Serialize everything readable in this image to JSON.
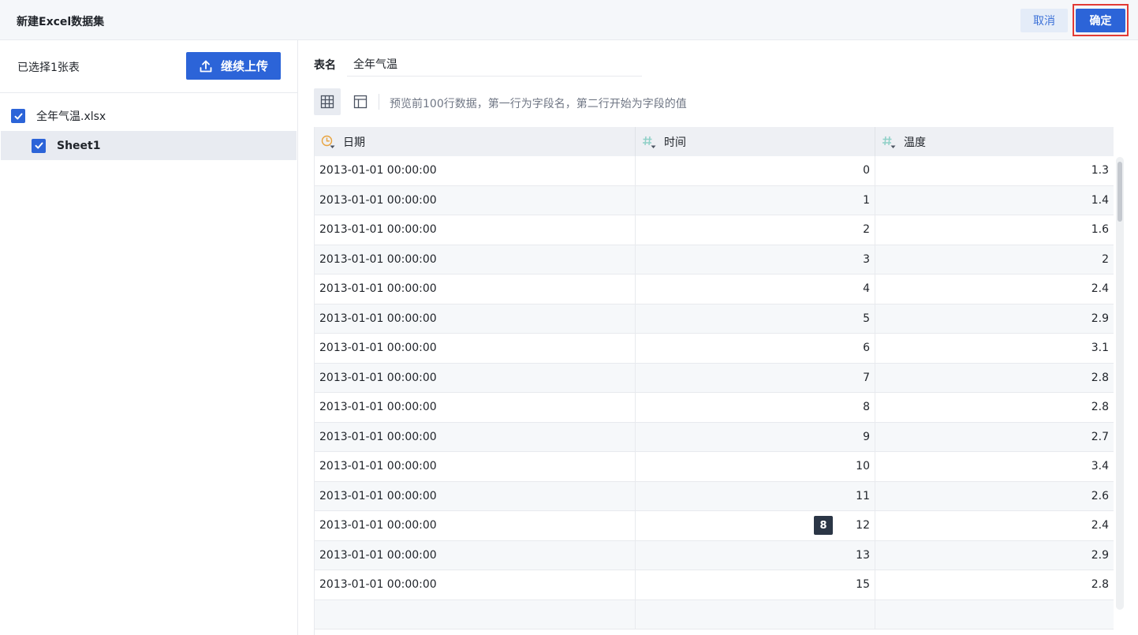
{
  "header": {
    "title": "新建Excel数据集",
    "cancel_label": "取消",
    "confirm_label": "确定"
  },
  "left_panel": {
    "selected_count": "已选择1张表",
    "upload_label": "继续上传",
    "file": {
      "name": "全年气温.xlsx",
      "checked": true
    },
    "sheet": {
      "name": "Sheet1",
      "checked": true
    }
  },
  "main": {
    "table_name_label": "表名",
    "table_name_value": "全年气温",
    "hint": "预览前100行数据，第一行为字段名，第二行开始为字段的值",
    "badge": "8",
    "columns": [
      {
        "name": "日期",
        "type_icon": "clock-icon",
        "type_color": "#e8a33d"
      },
      {
        "name": "时间",
        "type_icon": "hash-icon",
        "type_color": "#8fd0c7"
      },
      {
        "name": "温度",
        "type_icon": "hash-icon",
        "type_color": "#8fd0c7"
      }
    ],
    "rows": [
      [
        "2013-01-01 00:00:00",
        "0",
        "1.3"
      ],
      [
        "2013-01-01 00:00:00",
        "1",
        "1.4"
      ],
      [
        "2013-01-01 00:00:00",
        "2",
        "1.6"
      ],
      [
        "2013-01-01 00:00:00",
        "3",
        "2"
      ],
      [
        "2013-01-01 00:00:00",
        "4",
        "2.4"
      ],
      [
        "2013-01-01 00:00:00",
        "5",
        "2.9"
      ],
      [
        "2013-01-01 00:00:00",
        "6",
        "3.1"
      ],
      [
        "2013-01-01 00:00:00",
        "7",
        "2.8"
      ],
      [
        "2013-01-01 00:00:00",
        "8",
        "2.8"
      ],
      [
        "2013-01-01 00:00:00",
        "9",
        "2.7"
      ],
      [
        "2013-01-01 00:00:00",
        "10",
        "3.4"
      ],
      [
        "2013-01-01 00:00:00",
        "11",
        "2.6"
      ],
      [
        "2013-01-01 00:00:00",
        "12",
        "2.4"
      ],
      [
        "2013-01-01 00:00:00",
        "13",
        "2.9"
      ],
      [
        "2013-01-01 00:00:00",
        "15",
        "2.8"
      ],
      [
        "",
        "",
        ""
      ]
    ]
  },
  "colors": {
    "primary": "#2c64d8",
    "highlight_border": "#e23a35"
  }
}
